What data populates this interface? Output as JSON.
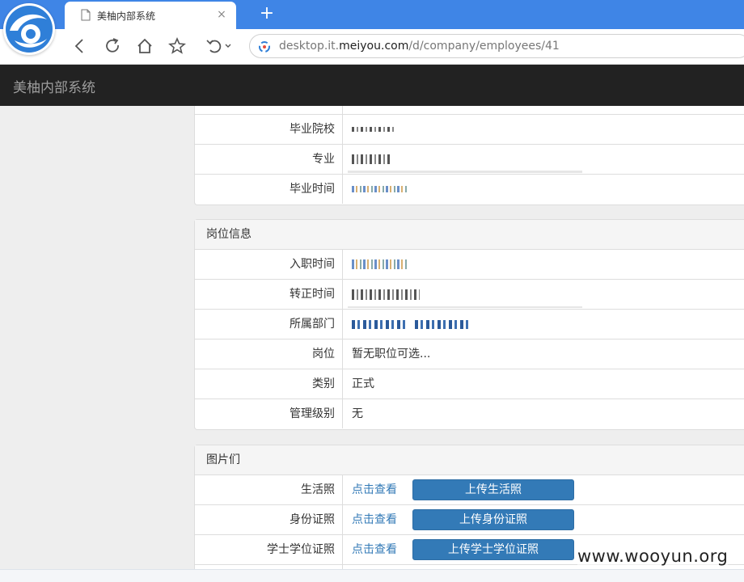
{
  "browser": {
    "tab_title": "美柚内部系统",
    "tab_close": "×",
    "new_tab": "+",
    "url_prefix": "desktop.it.",
    "url_domain": "meiyou.com",
    "url_path": "/d/company/employees/41",
    "accent": "#3f85e6"
  },
  "navbar": {
    "brand": "美柚内部系统",
    "bg": "#222222"
  },
  "education_panel": {
    "rows": [
      {
        "label": "毕业院校"
      },
      {
        "label": "专业"
      },
      {
        "label": "毕业时间"
      }
    ]
  },
  "position_panel": {
    "heading": "岗位信息",
    "rows": [
      {
        "label": "入职时间"
      },
      {
        "label": "转正时间"
      },
      {
        "label": "所属部门"
      },
      {
        "label": "岗位",
        "value": "暂无职位可选..."
      },
      {
        "label": "类别",
        "value": "正式"
      },
      {
        "label": "管理级别",
        "value": "无"
      }
    ]
  },
  "photos_panel": {
    "heading": "图片们",
    "rows": [
      {
        "label": "生活照",
        "link": "点击查看",
        "button": "上传生活照"
      },
      {
        "label": "身份证照",
        "link": "点击查看",
        "button": "上传身份证照"
      },
      {
        "label": "学士学位证照",
        "link": "点击查看",
        "button": "上传学士学位证照"
      }
    ]
  },
  "watermark": "www.wooyun.org"
}
